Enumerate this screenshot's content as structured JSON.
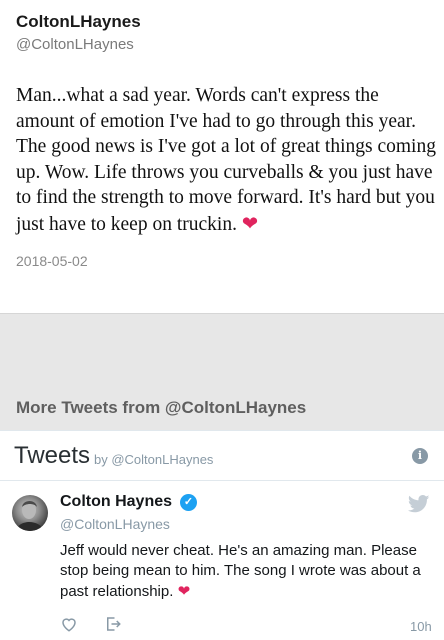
{
  "tweet": {
    "name": "ColtonLHaynes",
    "handle": "@ColtonLHaynes",
    "text": "Man...what a sad year. Words can't express the amount of emotion I've had to go through this year. The good news is I've got a lot of great things coming up. Wow. Life throws you curveballs & you just have to find the strength to move forward. It's hard but you just have to keep on truckin.",
    "heart": "❤",
    "date": "2018-05-02"
  },
  "more": {
    "title": "More Tweets from @ColtonLHaynes"
  },
  "timeline": {
    "title": "Tweets",
    "by": "by @ColtonLHaynes",
    "info_icon": "info-icon",
    "tweet": {
      "name": "Colton Haynes",
      "handle": "@ColtonLHaynes",
      "text": "Jeff would never cheat. He's an amazing man. Please stop being mean to him. The song I wrote was about a past relationship.",
      "heart": "❤",
      "time": "10h"
    }
  },
  "colors": {
    "heart": "#e0245e",
    "verified": "#1da1f2",
    "band": "#e7e7e7"
  }
}
